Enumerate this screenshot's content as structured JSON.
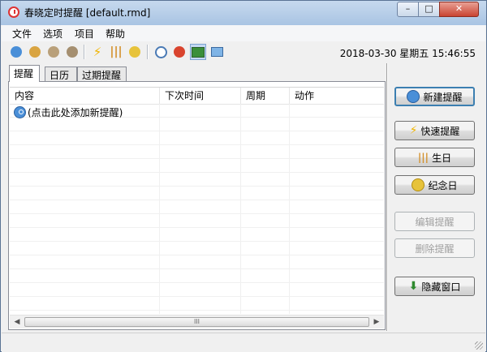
{
  "window": {
    "title": "春晓定时提醒 [default.rmd]",
    "min": "–",
    "max": "□",
    "close": "✕"
  },
  "menu": [
    "文件",
    "选项",
    "项目",
    "帮助"
  ],
  "clock": "2018-03-30 星期五 15:46:55",
  "tabs": [
    "提醒",
    "日历",
    "过期提醒"
  ],
  "columns": [
    "内容",
    "下次时间",
    "周期",
    "动作"
  ],
  "add_hint": "(点击此处添加新提醒)",
  "scroll": {
    "left": "◀",
    "right": "▶",
    "grip": "III"
  },
  "buttons": {
    "new": "新建提醒",
    "quick": "快速提醒",
    "birthday": "生日",
    "anniversary": "纪念日",
    "edit": "编辑提醒",
    "delete": "删除提醒",
    "hide": "隐藏窗口"
  },
  "icons": {
    "toolbar": [
      "clock-new-icon",
      "clock-edit-icon",
      "clock-delete-icon",
      "clock-settings-icon",
      "lightning-icon",
      "candles-icon",
      "medal-icon",
      "stopwatch-icon",
      "run-icon",
      "window-icon",
      "monitor-icon"
    ]
  },
  "colors": {
    "accent": "#3c7fb1",
    "close": "#c94431"
  }
}
